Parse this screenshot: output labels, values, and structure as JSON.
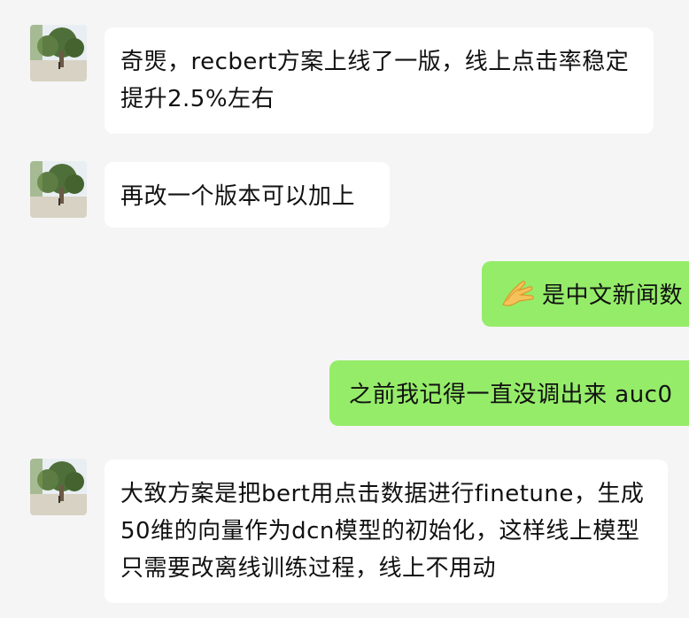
{
  "messages": [
    {
      "side": "in",
      "avatar": "contact-avatar",
      "text": "奇煚，recbert方案上线了一版，线上点击率稳定提升2.5%左右"
    },
    {
      "side": "in",
      "avatar": "contact-avatar",
      "text": "再改一个版本可以加上"
    },
    {
      "side": "out",
      "emoji": "pinched-hand-icon",
      "text": "是中文新闻数"
    },
    {
      "side": "out",
      "text": "之前我记得一直没调出来 auc0"
    },
    {
      "side": "in",
      "avatar": "contact-avatar",
      "text": "大致方案是把bert用点击数据进行finetune，生成50维的向量作为dcn模型的初始化，这样线上模型只需要改离线训练过程，线上不用动"
    }
  ],
  "colors": {
    "background": "#f5f5f5",
    "incoming_bubble": "#ffffff",
    "outgoing_bubble": "#95ec69",
    "text": "#111111"
  }
}
